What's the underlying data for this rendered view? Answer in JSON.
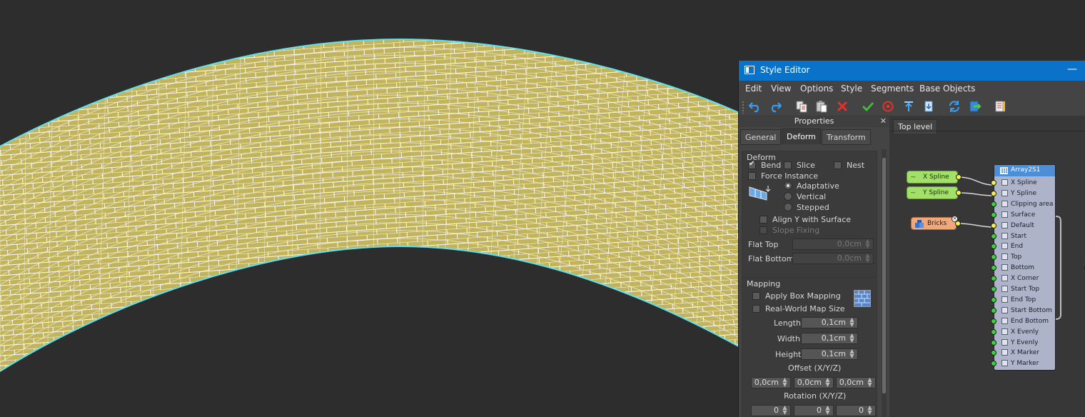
{
  "window": {
    "title": "Style Editor",
    "minimize_symbol": "—"
  },
  "menu": [
    "Edit",
    "View",
    "Options",
    "Style",
    "Segments",
    "Base Objects"
  ],
  "toolbar_icons": [
    "undo-icon",
    "redo-icon",
    "copy-icon",
    "paste-icon",
    "delete-icon",
    "check-icon",
    "stop-icon",
    "top-align-icon",
    "bottom-align-icon",
    "refresh-icon",
    "export-icon",
    "book-icon"
  ],
  "properties": {
    "header": "Properties",
    "close_symbol": "✕",
    "tabs": [
      "General",
      "Deform",
      "Transform"
    ],
    "active_tab": "Deform",
    "deform": {
      "title": "Deform",
      "bend_label": "Bend",
      "bend_checked": true,
      "slice_label": "Slice",
      "nest_label": "Nest",
      "force_instance_label": "Force Instance",
      "adaptative_label": "Adaptative",
      "vertical_label": "Vertical",
      "stepped_label": "Stepped",
      "align_y_label": "Align Y with Surface",
      "slope_fixing_label": "Slope Fixing",
      "flat_top_label": "Flat Top",
      "flat_top_value": "0,0cm",
      "flat_bottom_label": "Flat Bottom",
      "flat_bottom_value": "0,0cm"
    },
    "mapping": {
      "title": "Mapping",
      "apply_box_label": "Apply Box Mapping",
      "real_world_label": "Real-World Map Size",
      "length_label": "Length",
      "length_value": "0,1cm",
      "width_label": "Width",
      "width_value": "0,1cm",
      "height_label": "Height",
      "height_value": "0,1cm",
      "offset_label": "Offset (X/Y/Z)",
      "offset_values": [
        "0,0cm",
        "0,0cm",
        "0,0cm"
      ],
      "rotation_label": "Rotation (X/Y/Z)",
      "rotation_values": [
        "0",
        "0",
        "0"
      ]
    }
  },
  "node_editor": {
    "tab": "Top level",
    "x_spline": "X Spline",
    "y_spline": "Y Spline",
    "bricks": "Bricks",
    "array_title": "Array2S1",
    "array_ports": [
      "X Spline",
      "Y Spline",
      "Clipping area",
      "Surface",
      "Default",
      "Start",
      "End",
      "Top",
      "Bottom",
      "X Corner",
      "Start Top",
      "End Top",
      "Start Bottom",
      "End Bottom",
      "X Evenly",
      "Y Evenly",
      "X Marker",
      "Y Marker"
    ]
  },
  "colors": {
    "titlebar": "#0a73c9",
    "brick_fill": "#c2b45c",
    "outline": "#5ee0f0",
    "node_green": "#a3e06a",
    "node_orange": "#f0a77a",
    "node_blue": "#4d8fd6"
  }
}
